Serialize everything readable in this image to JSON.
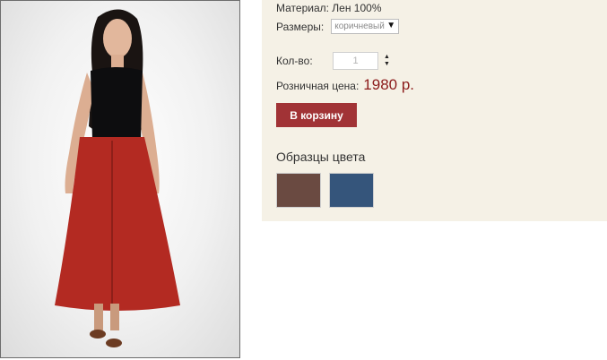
{
  "product": {
    "material_text": "Материал: Лен 100%",
    "sizes_label": "Размеры:",
    "size_selected": "коричневый",
    "quantity_label": "Кол-во:",
    "quantity_value": "1",
    "price_label": "Розничная цена:",
    "price_value": "1980 р.",
    "add_to_cart_label": "В корзину"
  },
  "swatches": {
    "title": "Образцы цвета",
    "items": [
      {
        "color": "#6a4a41"
      },
      {
        "color": "#35557b"
      }
    ]
  },
  "colors": {
    "panel_background": "#f5f1e6",
    "price": "#8b1a1a",
    "button": "#a13336"
  },
  "icons": {
    "select_arrow": "▼",
    "stepper_up": "▲",
    "stepper_down": "▼"
  }
}
